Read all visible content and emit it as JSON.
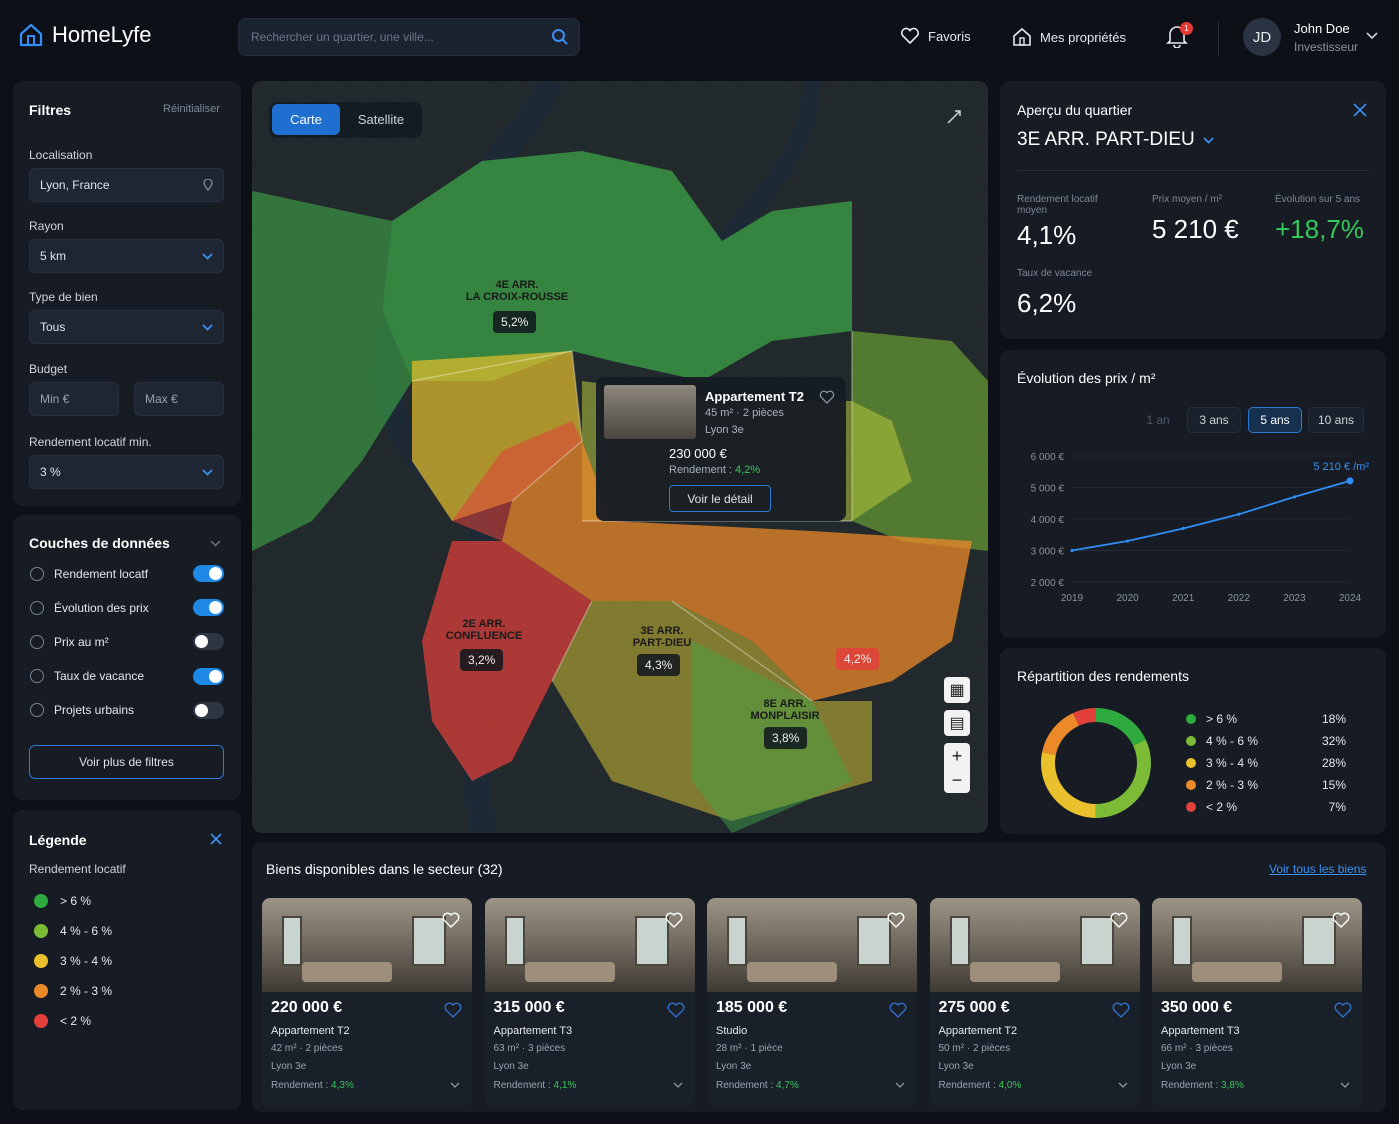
{
  "header": {
    "brand": "HomeLyfe",
    "search_placeholder": "Rechercher un quartier, une ville...",
    "favoris": "Favoris",
    "mes_proprietes": "Mes propriétés",
    "notif_count": "1",
    "user_initials": "JD",
    "user_name": "John Doe",
    "user_role": "Investisseur"
  },
  "filters": {
    "title": "Filtres",
    "reset": "Réinitialiser",
    "location_label": "Localisation",
    "location_value": "Lyon, France",
    "radius_label": "Rayon",
    "radius_value": "5 km",
    "type_label": "Type de bien",
    "type_value": "Tous",
    "budget_label": "Budget",
    "budget_min": "Min €",
    "budget_max": "Max €",
    "yield_label": "Rendement locatif min.",
    "yield_value": "3 %"
  },
  "layers": {
    "title": "Couches de données",
    "items": [
      {
        "label": "Rendement locatf",
        "on": true
      },
      {
        "label": "Évolution des prix",
        "on": true
      },
      {
        "label": "Prix au m²",
        "on": false
      },
      {
        "label": "Taux de vacance",
        "on": true
      },
      {
        "label": "Projets urbains",
        "on": false
      }
    ],
    "more": "Voir plus de filtres"
  },
  "legend": {
    "title": "Légende",
    "subtitle": "Rendement locatif",
    "items": [
      {
        "label": "> 6 %",
        "color": "#2eaa3f"
      },
      {
        "label": "4 % - 6 %",
        "color": "#7bbb35"
      },
      {
        "label": "3 % - 4 %",
        "color": "#e8c12c"
      },
      {
        "label": "2 % - 3 %",
        "color": "#ec8a2a"
      },
      {
        "label": "< 2 %",
        "color": "#e2403a"
      }
    ]
  },
  "map": {
    "tab_carte": "Carte",
    "tab_satellite": "Satellite",
    "zones": [
      {
        "name": "4E ARR.\nLA CROIX-ROUSSE",
        "value": "5,2%"
      },
      {
        "name": "2E ARR.\nCONFLUENCE",
        "value": "3,2%"
      },
      {
        "name": "3E ARR.\nPART-DIEU",
        "value": "4,3%"
      },
      {
        "name": "8E ARR.\nMONPLAISIR",
        "value": "3,8%"
      },
      {
        "name": "",
        "value": "4,2%"
      }
    ],
    "popup": {
      "title": "Appartement T2",
      "dims": "45 m² · 2 pièces",
      "loc": "Lyon 3e",
      "price": "230 000 €",
      "rend_label": "Rendement :",
      "rend_value": "4,2%",
      "cta": "Voir le détail"
    }
  },
  "overview": {
    "title": "Aperçu du quartier",
    "district": "3E ARR. PART-DIEU",
    "yield_label": "Rendement locatif moyen",
    "yield_value": "4,1%",
    "price_label": "Prix moyen / m²",
    "price_value": "5 210 €",
    "evo_label": "Évolution sur 5 ans",
    "evo_value": "+18,7%",
    "vac_label": "Taux de vacance",
    "vac_value": "6,2%"
  },
  "evolution": {
    "title": "Évolution des prix / m²",
    "ranges": [
      "1 an",
      "3 ans",
      "5 ans",
      "10 ans"
    ],
    "active_range": "5 ans",
    "last_label": "5 210 € /m²"
  },
  "repartition": {
    "title": "Répartition des rendements",
    "items": [
      {
        "label": "> 6 %",
        "pct": "18%",
        "value": 18,
        "color": "#2eaa3f"
      },
      {
        "label": "4 % - 6 %",
        "pct": "32%",
        "value": 32,
        "color": "#7bbb35"
      },
      {
        "label": "3 % - 4 %",
        "pct": "28%",
        "value": 28,
        "color": "#e8c12c"
      },
      {
        "label": "2 % - 3 %",
        "pct": "15%",
        "value": 15,
        "color": "#ec8a2a"
      },
      {
        "label": "< 2 %",
        "pct": "7%",
        "value": 7,
        "color": "#e2403a"
      }
    ]
  },
  "listings": {
    "title": "Biens disponibles dans le secteur (32)",
    "see_all": "Voir tous les biens",
    "rend_label": "Rendement :",
    "cards": [
      {
        "price": "220 000 €",
        "type": "Appartement T2",
        "dims": "42 m² · 2 pièces",
        "loc": "Lyon 3e",
        "rend": "4,3%"
      },
      {
        "price": "315 000 €",
        "type": "Appartement T3",
        "dims": "63 m² · 3 pièces",
        "loc": "Lyon 3e",
        "rend": "4,1%"
      },
      {
        "price": "185 000 €",
        "type": "Studio",
        "dims": "28 m² · 1 pièce",
        "loc": "Lyon 3e",
        "rend": "4,7%"
      },
      {
        "price": "275 000 €",
        "type": "Appartement T2",
        "dims": "50 m² · 2 pièces",
        "loc": "Lyon 3e",
        "rend": "4,0%"
      },
      {
        "price": "350 000 €",
        "type": "Appartement T3",
        "dims": "66 m² · 3 pièces",
        "loc": "Lyon 3e",
        "rend": "3,8%"
      }
    ]
  },
  "chart_data": {
    "type": "line",
    "title": "Évolution des prix / m²",
    "x": [
      2019,
      2020,
      2021,
      2022,
      2023,
      2024
    ],
    "series": [
      {
        "values": [
          3000,
          3300,
          3700,
          4150,
          4700,
          5210
        ]
      }
    ],
    "xlim": [
      2019,
      2024
    ],
    "ylim": [
      2000,
      6000
    ],
    "yticks": [
      "2 000 €",
      "3 000 €",
      "4 000 €",
      "5 000 €",
      "6 000 €"
    ],
    "xticks": [
      "2019",
      "2020",
      "2021",
      "2022",
      "2023",
      "2024"
    ],
    "end_label": "5 210 € /m²",
    "grid": true
  }
}
